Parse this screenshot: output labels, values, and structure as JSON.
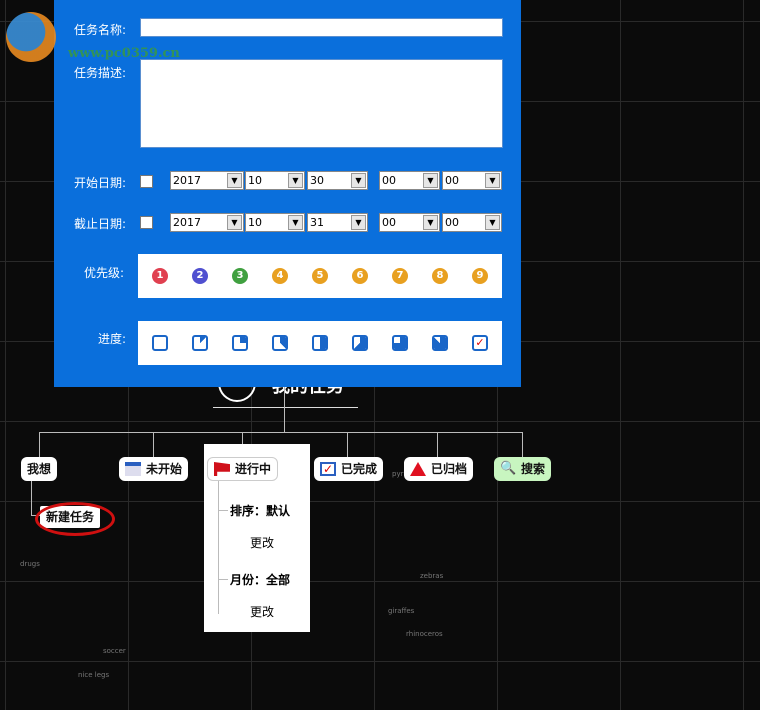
{
  "form": {
    "name_label": "任务名称:",
    "name_value": "",
    "desc_label": "任务描述:",
    "desc_value": "",
    "start_label": "开始日期:",
    "start": {
      "year": "2017",
      "month": "10",
      "day": "30",
      "hour": "00",
      "minute": "00"
    },
    "end_label": "截止日期:",
    "end": {
      "year": "2017",
      "month": "10",
      "day": "31",
      "hour": "00",
      "minute": "00"
    },
    "priority_label": "优先级:",
    "priorities": [
      "1",
      "2",
      "3",
      "4",
      "5",
      "6",
      "7",
      "8",
      "9"
    ],
    "priority_colors": [
      "#e04050",
      "#5050d0",
      "#40a040",
      "#e8a020",
      "#e8a020",
      "#e8a020",
      "#e8a020",
      "#e8a020",
      "#e8a020"
    ],
    "progress_label": "进度:",
    "progress_levels": [
      0,
      0.125,
      0.25,
      0.375,
      0.5,
      0.625,
      0.75,
      0.875,
      1
    ]
  },
  "tree": {
    "title": "我的任务",
    "nodes": [
      "我想",
      "未开始",
      "进行中",
      "已完成",
      "已归档",
      "搜索"
    ],
    "new_task": "新建任务",
    "sort_label": "排序：默认",
    "month_label": "月份：全部",
    "change": "更改"
  },
  "map_labels": [
    "drugs",
    "soccer",
    "nice legs",
    "zebras",
    "giraffes",
    "rhinoceros",
    "pyramids"
  ],
  "watermark": "www.pc0359.cn"
}
